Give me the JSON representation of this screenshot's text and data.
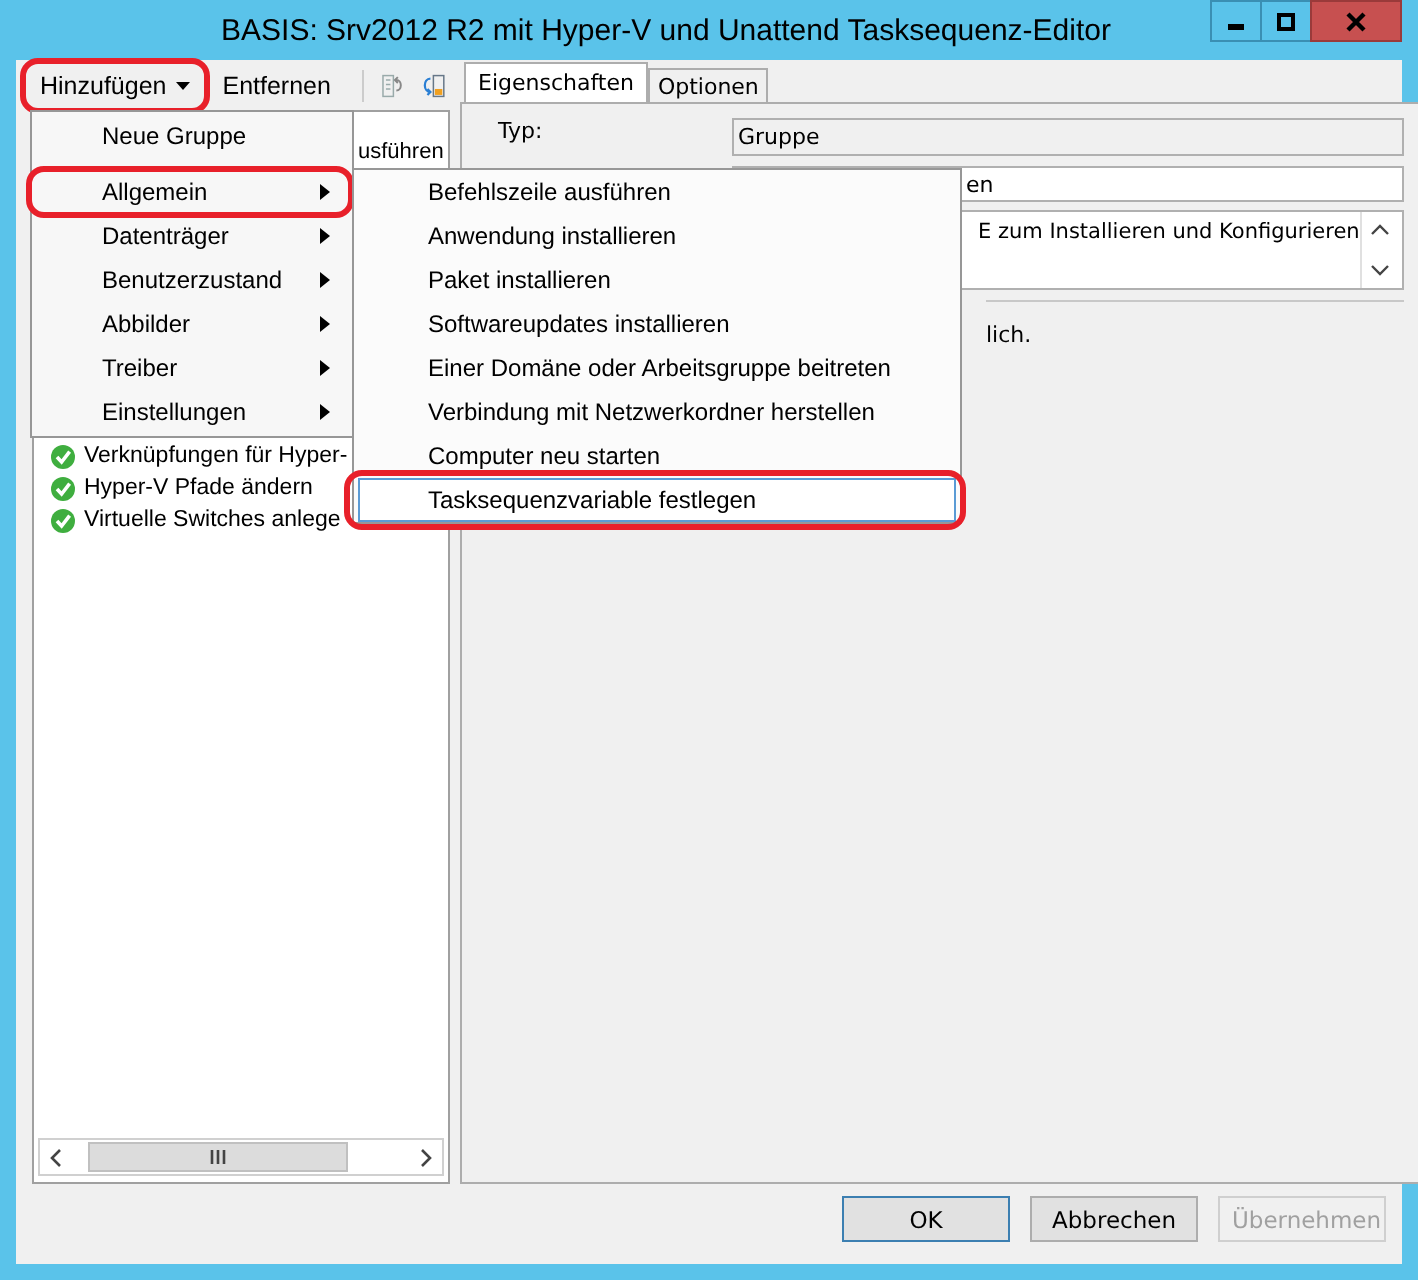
{
  "window": {
    "title": "BASIS: Srv2012 R2 mit Hyper-V und Unattend Tasksequenz-Editor"
  },
  "toolbar": {
    "buttons": [
      {
        "label": "Hinzufügen",
        "kind": "dropdown",
        "highlighted": true
      },
      {
        "label": "Entfernen",
        "kind": "plain",
        "highlighted": false
      }
    ]
  },
  "tree": {
    "items": [
      {
        "label": "usführen",
        "completed": false
      },
      {
        "label": "Verknüpfungen für Hyper-",
        "completed": true
      },
      {
        "label": "Hyper-V Pfade ändern",
        "completed": true
      },
      {
        "label": "Virtuelle Switches anlege",
        "completed": true
      }
    ]
  },
  "add_menu": {
    "items": [
      {
        "label": "Neue Gruppe",
        "submenu": false,
        "highlighted": false
      },
      {
        "label": "Allgemein",
        "submenu": true,
        "highlighted": true
      },
      {
        "label": "Datenträger",
        "submenu": true,
        "highlighted": false
      },
      {
        "label": "Benutzerzustand",
        "submenu": true,
        "highlighted": false
      },
      {
        "label": "Abbilder",
        "submenu": true,
        "highlighted": false
      },
      {
        "label": "Treiber",
        "submenu": true,
        "highlighted": false
      },
      {
        "label": "Einstellungen",
        "submenu": true,
        "highlighted": false
      }
    ]
  },
  "submenu": {
    "items": [
      {
        "label": "Befehlszeile ausführen",
        "hovered": false,
        "highlighted": false
      },
      {
        "label": "Anwendung installieren",
        "hovered": false,
        "highlighted": false
      },
      {
        "label": "Paket installieren",
        "hovered": false,
        "highlighted": false
      },
      {
        "label": "Softwareupdates installieren",
        "hovered": false,
        "highlighted": false
      },
      {
        "label": "Einer Domäne oder Arbeitsgruppe beitreten",
        "hovered": false,
        "highlighted": false
      },
      {
        "label": "Verbindung mit Netzwerkordner herstellen",
        "hovered": false,
        "highlighted": false
      },
      {
        "label": "Computer neu starten",
        "hovered": false,
        "highlighted": false
      },
      {
        "label": "Tasksequenzvariable festlegen",
        "hovered": true,
        "highlighted": true
      }
    ]
  },
  "tabs": [
    {
      "label": "Eigenschaften",
      "selected": true
    },
    {
      "label": "Optionen",
      "selected": false
    }
  ],
  "properties": {
    "type_label": "Typ:",
    "type_value": "Gruppe",
    "name_value": "en",
    "description_value": "E zum Installieren und Konfigurieren",
    "note": "lich."
  },
  "buttons": [
    {
      "label": "OK",
      "kind": "default",
      "disabled": false
    },
    {
      "label": "Abbrechen",
      "kind": "normal",
      "disabled": false
    },
    {
      "label": "Übernehmen",
      "kind": "normal",
      "disabled": true
    }
  ]
}
